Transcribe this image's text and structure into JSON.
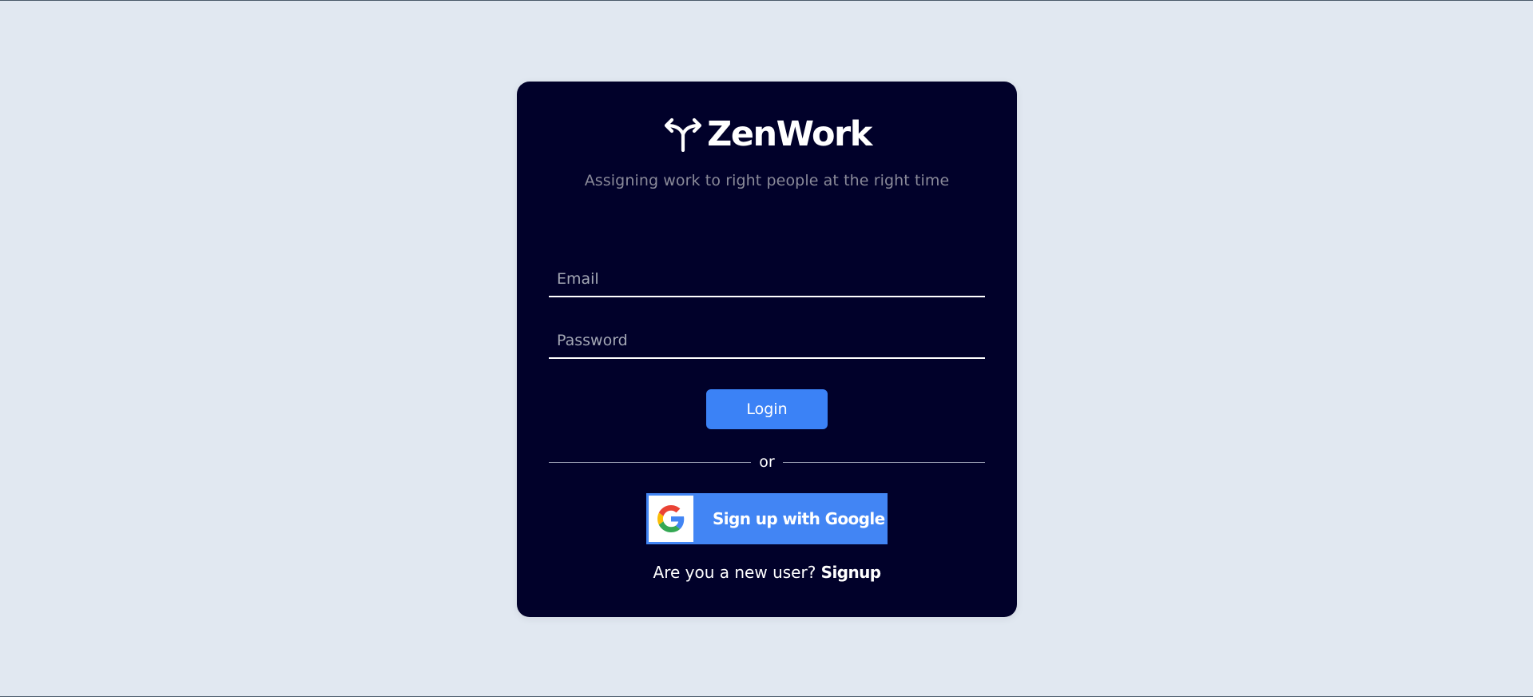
{
  "brand": {
    "name": "ZenWork",
    "icon": "split-arrows-icon",
    "tagline": "Assigning work to right people at the right time"
  },
  "form": {
    "email_placeholder": "Email",
    "email_value": "",
    "password_placeholder": "Password",
    "password_value": "",
    "login_label": "Login",
    "divider_text": "or",
    "google_label": "Sign up with Google",
    "google_icon": "google-g-icon"
  },
  "footer": {
    "prompt": "Are you a new user?",
    "signup_label": "Signup"
  },
  "colors": {
    "page_background": "#e1e8f1",
    "card_background": "#01012a",
    "accent": "#3b82f6",
    "google_blue": "#4285f4",
    "tagline": "#8a8a99"
  }
}
